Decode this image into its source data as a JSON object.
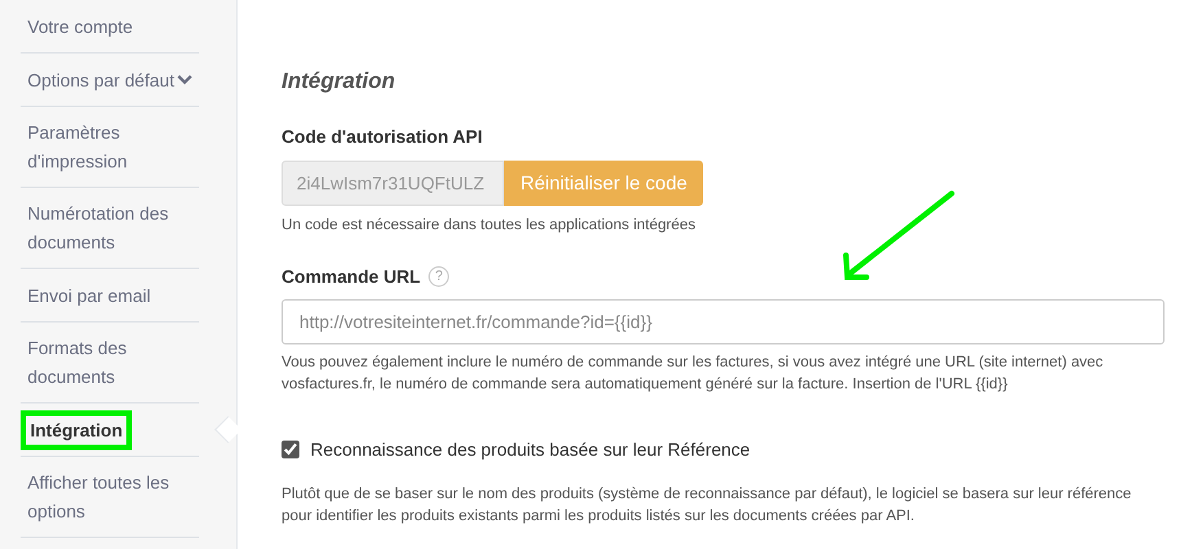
{
  "sidebar": {
    "items": [
      {
        "label": "Votre compte",
        "selected": false,
        "highlighted": false,
        "expandable": false
      },
      {
        "label": "Options par défaut",
        "selected": false,
        "highlighted": false,
        "expandable": true
      },
      {
        "label": "Paramètres d'impression",
        "selected": false,
        "highlighted": false,
        "expandable": false
      },
      {
        "label": "Numérotation des documents",
        "selected": false,
        "highlighted": false,
        "expandable": false
      },
      {
        "label": "Envoi par email",
        "selected": false,
        "highlighted": false,
        "expandable": false
      },
      {
        "label": "Formats des documents",
        "selected": false,
        "highlighted": false,
        "expandable": false
      },
      {
        "label": "Intégration",
        "selected": true,
        "highlighted": true,
        "expandable": false
      },
      {
        "label": "Afficher toutes les options",
        "selected": false,
        "highlighted": false,
        "expandable": false
      }
    ]
  },
  "section_title": "Intégration",
  "api_code": {
    "label": "Code d'autorisation API",
    "value": "2i4LwIsm7r31UQFtULZ",
    "button": "Réinitialiser le code",
    "help": "Un code est nécessaire dans toutes les applications intégrées"
  },
  "order_url": {
    "label": "Commande URL",
    "help_icon": "?",
    "placeholder": "http://votresiteinternet.fr/commande?id={{id}}",
    "help": "Vous pouvez également inclure le numéro de commande sur les factures, si vous avez intégré une URL (site internet) avec vosfactures.fr, le numéro de commande sera automatiquement généré sur la facture. Insertion de l'URL {{id}}"
  },
  "product_recognition": {
    "label": "Reconnaissance des produits basée sur leur Référence",
    "checked": true,
    "help": "Plutôt que de se baser sur le nom des produits (système de reconnaissance par défaut), le logiciel se basera sur leur référence pour identifier les produits existants parmi les produits listés sur les documents créées par API."
  }
}
